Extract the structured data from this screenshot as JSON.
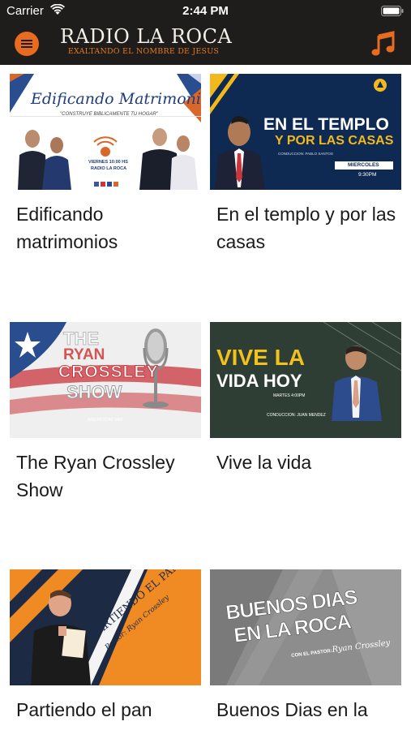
{
  "status_bar": {
    "carrier": "Carrier",
    "time": "2:44 PM"
  },
  "nav": {
    "logo_title": "RADIO LA ROCA",
    "logo_subtitle": "EXALTANDO EL NOMBRE DE JESUS",
    "menu_icon": "hamburger-icon",
    "music_icon": "music-note-icon",
    "accent_color": "#e86b1f"
  },
  "programs": [
    {
      "title": "Edificando matrimonios",
      "thumb": {
        "heading": "Edificando Matrimonios",
        "tagline": "\"CONSTRUYE BIBLICAMENTE TU HOGAR\"",
        "schedule": "VIERNES 10:00 HS",
        "station": "RADIO LA ROCA"
      }
    },
    {
      "title": "En el templo y por las casas",
      "thumb": {
        "line1": "EN EL TEMPLO",
        "line2": "Y POR LAS CASAS",
        "host": "CONDUCCION: PABLO SANTOS",
        "day": "MIERCOLES",
        "time": "9:30PM"
      }
    },
    {
      "title": "The Ryan Crossley Show",
      "thumb": {
        "line1": "THE",
        "line2": "RYAN",
        "line3": "CROSSLEY",
        "line4": "SHOW",
        "day": "WEDNESDAY 9AM"
      }
    },
    {
      "title": "Vive la vida",
      "thumb": {
        "line1": "VIVE LA",
        "line2": "VIDA HOY",
        "schedule": "MARTES 4:00PM",
        "host": "CONDUCCION: JUAN MENDEZ"
      }
    },
    {
      "title": "Partiendo el pan",
      "thumb": {
        "line1": "\"PARTIENDO EL PAN\"",
        "line2": "Pastor: Ryan Crossley"
      }
    },
    {
      "title": "Buenos Dias en la Roca",
      "thumb": {
        "line1": "BUENOS DIAS",
        "line2": "EN LA ROCA",
        "line3": "CON EL PASTOR:",
        "signature": "Ryan Crossley"
      }
    }
  ]
}
